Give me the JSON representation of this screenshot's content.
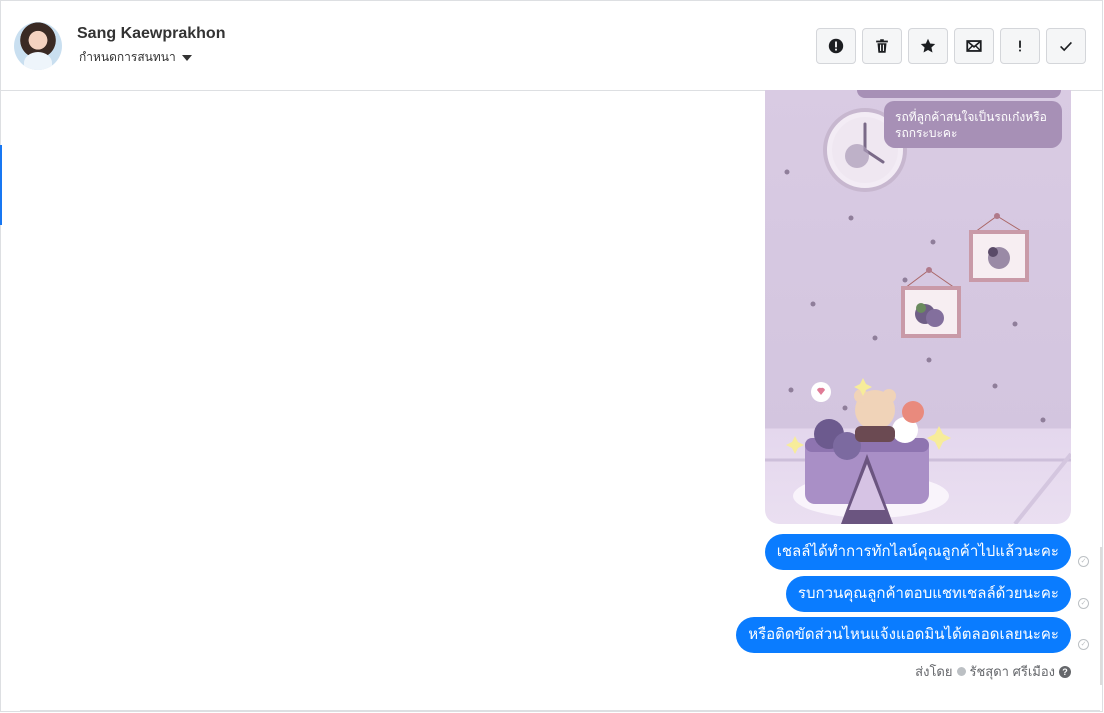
{
  "header": {
    "contact_name": "Sang Kaewprakhon",
    "assign_label": "กำหนดการสนทนา"
  },
  "toolbar": {
    "buttons": [
      {
        "name": "spam",
        "icon": "alert-circle-icon"
      },
      {
        "name": "delete",
        "icon": "trash-icon"
      },
      {
        "name": "star",
        "icon": "star-icon"
      },
      {
        "name": "mark-unread",
        "icon": "envelope-icon"
      },
      {
        "name": "follow-up",
        "icon": "exclamation-icon"
      },
      {
        "name": "done",
        "icon": "check-icon"
      }
    ]
  },
  "attachment": {
    "inner_message": "รถที่ลูกค้าสนใจเป็นรถเก๋งหรือรถกระบะคะ"
  },
  "messages": [
    {
      "text": "เชลล์ได้ทำการทักไลน์คุณลูกค้าไปแล้วนะคะ"
    },
    {
      "text": "รบกวนคุณลูกค้าตอบแชทเชลล์ด้วยนะคะ"
    },
    {
      "text": "หรือติดขัดส่วนไหนแจ้งแอดมินได้ตลอดเลยนะคะ"
    }
  ],
  "sent_by": {
    "label": "ส่งโดย",
    "name": "รัชสุดา ศรีเมือง"
  },
  "colors": {
    "accent": "#0a7cff",
    "attachment_bg": "#d3c5df"
  }
}
